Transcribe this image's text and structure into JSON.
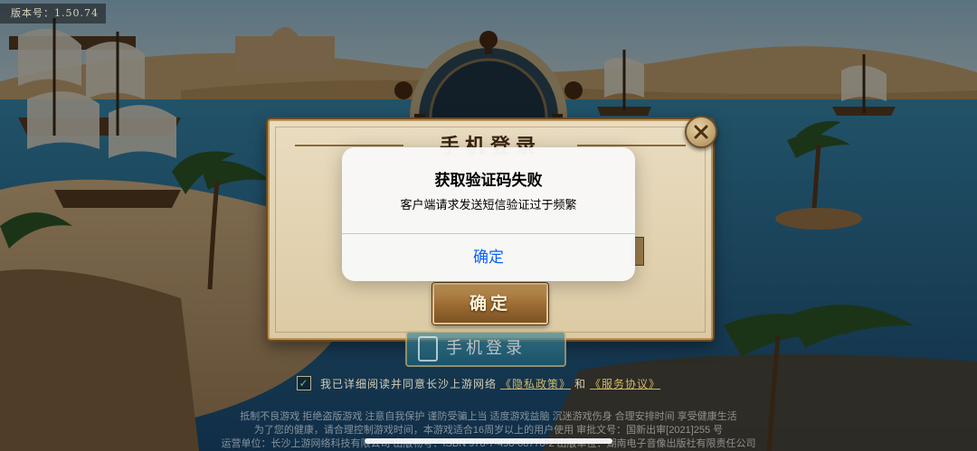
{
  "version_label": "版本号：1.50.74",
  "game_dialog": {
    "title": "手机登录",
    "confirm_label": "确定"
  },
  "phone_login_label": "手机登录",
  "agreement": {
    "prefix": "我已详细阅读并同意长沙上游网络",
    "privacy_link": "《隐私政策》",
    "conjunction": "和",
    "service_link": "《服务协议》",
    "checked": true
  },
  "footer": {
    "line1": "抵制不良游戏 拒绝盗版游戏 注意自我保护 谨防受骗上当 适度游戏益脑 沉迷游戏伤身 合理安排时间 享受健康生活",
    "line2": "为了您的健康，请合理控制游戏时间，本游戏适合16周岁以上的用户使用 审批文号：国新出审[2021]255 号",
    "line3": "运营单位：长沙上游网络科技有限公司 出版物号：ISBN 978-7-498-08778-2 出版单位：湖南电子音像出版社有限责任公司"
  },
  "alert": {
    "title": "获取验证码失败",
    "message": "客户端请求发送短信验证过于频繁",
    "button_label": "确定",
    "button_color": "#0a60ff"
  }
}
